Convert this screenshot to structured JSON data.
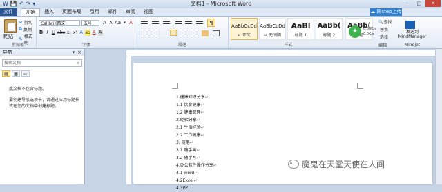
{
  "window": {
    "title": "文档1 - Microsoft Word",
    "qat": [
      "W",
      "💾",
      "↶",
      "↷",
      "▾"
    ],
    "controls": [
      "─",
      "□",
      "✕"
    ]
  },
  "tabs": {
    "file": "文件",
    "items": [
      "开始",
      "插入",
      "页面布局",
      "引用",
      "邮件",
      "审阅",
      "视图"
    ],
    "active": "开始",
    "upload": "同step上传"
  },
  "ribbon": {
    "clipboard": {
      "paste": "粘贴",
      "cut": "剪切",
      "copy": "复制",
      "painter": "格式刷",
      "group": "剪贴板"
    },
    "font": {
      "name": "Calibri (西文)",
      "size": "五号",
      "group": "字体",
      "row1": [
        "A",
        "A",
        "Aa",
        "▾",
        "A"
      ],
      "row2": [
        "B",
        "I",
        "U",
        "abe",
        "x₂",
        "x²",
        "A",
        "ab",
        "A",
        "A"
      ]
    },
    "paragraph": {
      "group": "段落"
    },
    "styles": {
      "group": "样式",
      "items": [
        {
          "sample": "AaBbCcDd",
          "name": "↵ 正文"
        },
        {
          "sample": "AaBbCcDd",
          "name": "↵ 无间隔"
        },
        {
          "sample": "AaBl",
          "name": "标题 1"
        },
        {
          "sample": "AaBb(",
          "name": "标题 2"
        },
        {
          "sample": "AaBb(",
          "name": "标题"
        }
      ]
    },
    "editing": {
      "find": "查找",
      "replace": "替换",
      "select": "选择",
      "group": "编辑"
    },
    "network": {
      "speed": "0.00K/s",
      "speed2": "0.0K/s"
    },
    "mindjet": {
      "label1": "发送到",
      "label2": "MindManager",
      "group": "Mindjet"
    }
  },
  "nav": {
    "title": "导航",
    "search_placeholder": "搜索文档",
    "tabs": [
      "▤",
      "▦",
      "▭"
    ],
    "msg1": "此文档不包含标题。",
    "msg2": "要创建导航选项卡，请通过应用标题样式在您的文档中创建标题。"
  },
  "document": {
    "lines": [
      "1.健康知识分享",
      "1.1 饮食健康",
      "1.2 健康管理",
      "2.经验分享",
      "2.1 生活经验",
      "2.2 工作健康",
      "3. 随笔",
      "3.1 随手画",
      "3.2 随手写",
      "4.办公软件操作分享",
      "4.1 word",
      "4.2Excel",
      "4.3PPT"
    ],
    "mark": "↵"
  },
  "watermark": {
    "text": "魔鬼在天堂天使在人间"
  }
}
